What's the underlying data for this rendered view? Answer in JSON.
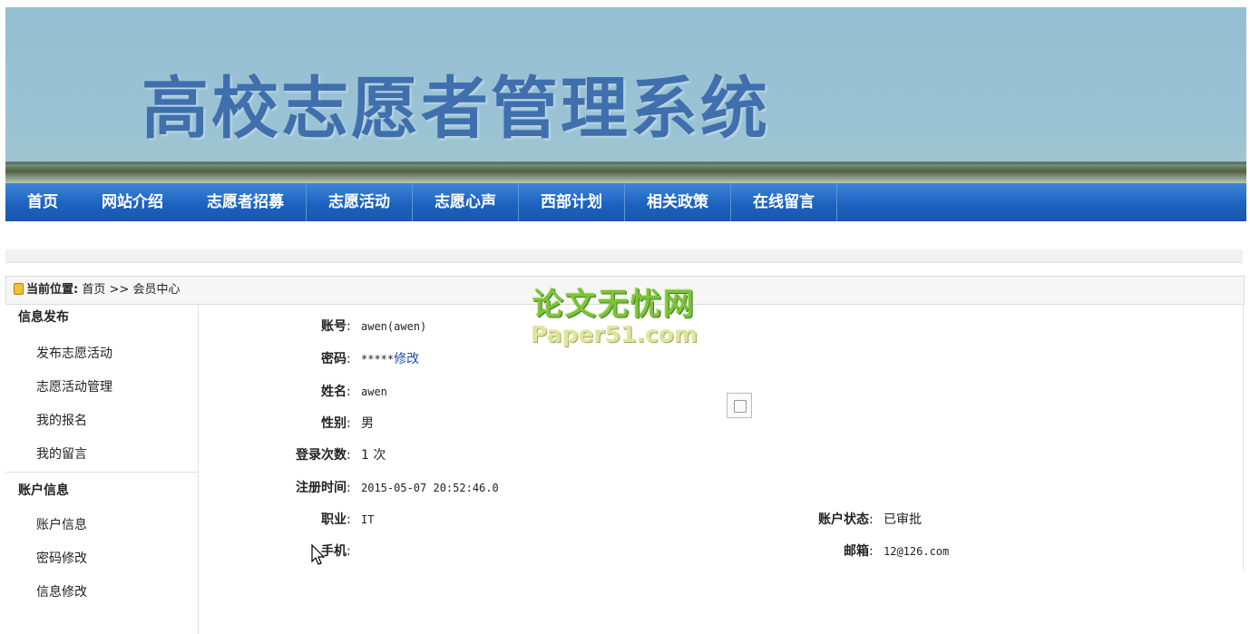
{
  "banner": {
    "title": "高校志愿者管理系统"
  },
  "nav": [
    "首页",
    "网站介绍",
    "志愿者招募",
    "志愿活动",
    "志愿心声",
    "西部计划",
    "相关政策",
    "在线留言"
  ],
  "breadcrumb": {
    "label": "当前位置:",
    "home": "首页",
    "sep": ">>",
    "current": "会员中心"
  },
  "sidebar": {
    "sections": [
      {
        "title": "信息发布",
        "items": [
          "发布志愿活动",
          "志愿活动管理",
          "我的报名",
          "我的留言"
        ]
      },
      {
        "title": "账户信息",
        "items": [
          "账户信息",
          "密码修改",
          "信息修改"
        ]
      }
    ]
  },
  "watermark": {
    "cn": "论文无忧网",
    "en": "Paper51.com"
  },
  "profile": {
    "account_label": "账号",
    "account_value": "awen(awen)",
    "password_label": "密码",
    "password_value": "*****",
    "password_link": "修改",
    "name_label": "姓名",
    "name_value": "awen",
    "gender_label": "性别",
    "gender_value": "男",
    "login_label": "登录次数",
    "login_value": "1 次",
    "reg_label": "注册时间",
    "reg_value": "2015-05-07 20:52:46.0",
    "job_label": "职业",
    "job_value": "IT",
    "status_label": "账户状态",
    "status_value": "已审批",
    "phone_label": "手机",
    "phone_value": "",
    "email_label": "邮箱",
    "email_value": "12@126.com",
    "colon": ":"
  }
}
